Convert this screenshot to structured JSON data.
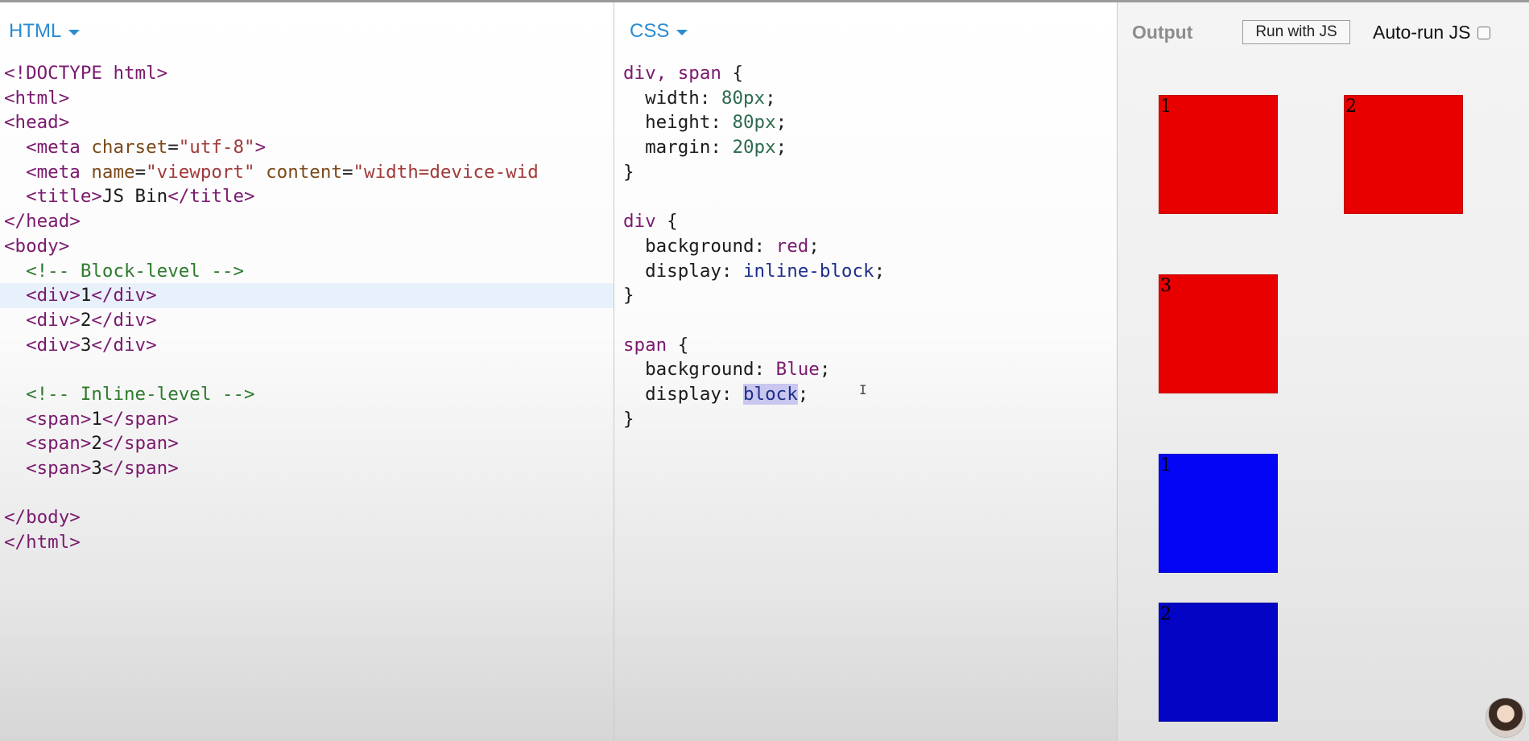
{
  "html_panel": {
    "title": "HTML",
    "code": [
      [
        [
          "tag",
          "<!DOCTYPE html>"
        ]
      ],
      [
        [
          "tag",
          "<html>"
        ]
      ],
      [
        [
          "tag",
          "<head>"
        ]
      ],
      [
        [
          "txt",
          "  "
        ],
        [
          "tag",
          "<meta "
        ],
        [
          "attr",
          "charset"
        ],
        [
          "txt",
          "="
        ],
        [
          "str",
          "\"utf-8\""
        ],
        [
          "tag",
          ">"
        ]
      ],
      [
        [
          "txt",
          "  "
        ],
        [
          "tag",
          "<meta "
        ],
        [
          "attr",
          "name"
        ],
        [
          "txt",
          "="
        ],
        [
          "str",
          "\"viewport\""
        ],
        [
          "txt",
          " "
        ],
        [
          "attr",
          "content"
        ],
        [
          "txt",
          "="
        ],
        [
          "str",
          "\"width=device-wid"
        ]
      ],
      [
        [
          "txt",
          "  "
        ],
        [
          "tag",
          "<title>"
        ],
        [
          "txt",
          "JS Bin"
        ],
        [
          "tag",
          "</title>"
        ]
      ],
      [
        [
          "tag",
          "</head>"
        ]
      ],
      [
        [
          "tag",
          "<body>"
        ]
      ],
      [
        [
          "txt",
          "  "
        ],
        [
          "comment",
          "<!-- Block-level -->"
        ]
      ],
      [
        [
          "txt",
          "  "
        ],
        [
          "tag",
          "<div>"
        ],
        [
          "txt",
          "1"
        ],
        [
          "tag",
          "</div>"
        ]
      ],
      [
        [
          "txt",
          "  "
        ],
        [
          "tag",
          "<div>"
        ],
        [
          "txt",
          "2"
        ],
        [
          "tag",
          "</div>"
        ]
      ],
      [
        [
          "txt",
          "  "
        ],
        [
          "tag",
          "<div>"
        ],
        [
          "txt",
          "3"
        ],
        [
          "tag",
          "</div>"
        ]
      ],
      [
        [
          "txt",
          ""
        ]
      ],
      [
        [
          "txt",
          "  "
        ],
        [
          "comment",
          "<!-- Inline-level -->"
        ]
      ],
      [
        [
          "txt",
          "  "
        ],
        [
          "tag",
          "<span>"
        ],
        [
          "txt",
          "1"
        ],
        [
          "tag",
          "</span>"
        ]
      ],
      [
        [
          "txt",
          "  "
        ],
        [
          "tag",
          "<span>"
        ],
        [
          "txt",
          "2"
        ],
        [
          "tag",
          "</span>"
        ]
      ],
      [
        [
          "txt",
          "  "
        ],
        [
          "tag",
          "<span>"
        ],
        [
          "txt",
          "3"
        ],
        [
          "tag",
          "</span>"
        ]
      ],
      [
        [
          "txt",
          ""
        ]
      ],
      [
        [
          "tag",
          "</body>"
        ]
      ],
      [
        [
          "tag",
          "</html>"
        ]
      ]
    ],
    "active_line": 9
  },
  "css_panel": {
    "title": "CSS",
    "code": [
      [
        [
          "sel",
          "div, span"
        ],
        [
          "punc",
          " {"
        ]
      ],
      [
        [
          "prop",
          "  width: "
        ],
        [
          "num",
          "80px"
        ],
        [
          "punc",
          ";"
        ]
      ],
      [
        [
          "prop",
          "  height: "
        ],
        [
          "num",
          "80px"
        ],
        [
          "punc",
          ";"
        ]
      ],
      [
        [
          "prop",
          "  margin: "
        ],
        [
          "num",
          "20px"
        ],
        [
          "punc",
          ";"
        ]
      ],
      [
        [
          "punc",
          "}"
        ]
      ],
      [
        [
          "txt",
          ""
        ]
      ],
      [
        [
          "sel",
          "div"
        ],
        [
          "punc",
          " {"
        ]
      ],
      [
        [
          "prop",
          "  background: "
        ],
        [
          "kw",
          "red"
        ],
        [
          "punc",
          ";"
        ]
      ],
      [
        [
          "prop",
          "  display: "
        ],
        [
          "kw2",
          "inline-block"
        ],
        [
          "punc",
          ";"
        ]
      ],
      [
        [
          "punc",
          "}"
        ]
      ],
      [
        [
          "txt",
          ""
        ]
      ],
      [
        [
          "sel",
          "span"
        ],
        [
          "punc",
          " {"
        ]
      ],
      [
        [
          "prop",
          "  background: "
        ],
        [
          "kw",
          "Blue"
        ],
        [
          "punc",
          ";"
        ]
      ],
      [
        [
          "prop",
          "  display: "
        ],
        [
          "hl",
          "block"
        ],
        [
          "punc",
          ";"
        ]
      ],
      [
        [
          "punc",
          "}"
        ]
      ]
    ]
  },
  "output_panel": {
    "title": "Output",
    "run_button": "Run with JS",
    "autorun_label": "Auto-run JS",
    "autorun_checked": false,
    "boxes": [
      {
        "label": "1",
        "color": "#e80000",
        "kind": "div"
      },
      {
        "label": "2",
        "color": "#e80000",
        "kind": "div"
      },
      {
        "label": "3",
        "color": "#e80000",
        "kind": "div"
      },
      {
        "label": "1",
        "color": "#0505f5",
        "kind": "span"
      },
      {
        "label": "2",
        "color": "#0404c4",
        "kind": "span"
      }
    ]
  }
}
